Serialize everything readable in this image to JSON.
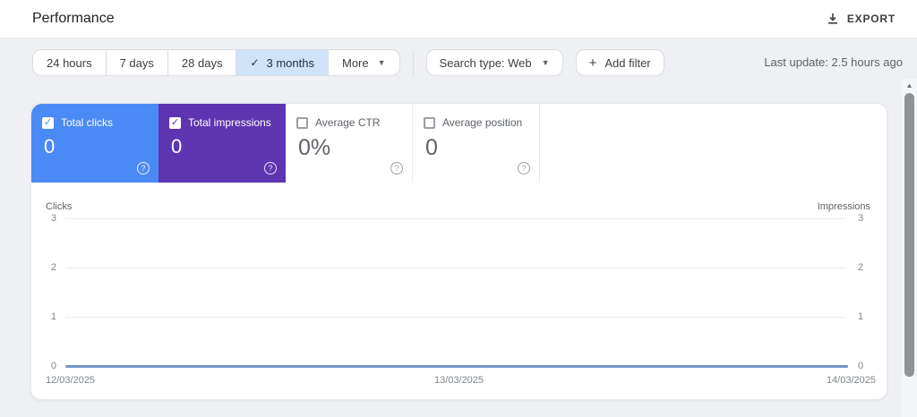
{
  "header": {
    "title": "Performance",
    "export_label": "EXPORT"
  },
  "filters": {
    "date_ranges": [
      {
        "label": "24 hours",
        "selected": false
      },
      {
        "label": "7 days",
        "selected": false
      },
      {
        "label": "28 days",
        "selected": false
      },
      {
        "label": "3 months",
        "selected": true
      }
    ],
    "more_label": "More",
    "search_type_label": "Search type: Web",
    "add_filter_label": "Add filter",
    "last_update": "Last update: 2.5 hours ago"
  },
  "metrics": {
    "cards": [
      {
        "label": "Total clicks",
        "value": "0",
        "checked": true,
        "color": "#4a8af4"
      },
      {
        "label": "Total impressions",
        "value": "0",
        "checked": true,
        "color": "#5e35b1"
      },
      {
        "label": "Average CTR",
        "value": "0%",
        "checked": false,
        "color": "#ffffff"
      },
      {
        "label": "Average position",
        "value": "0",
        "checked": false,
        "color": "#ffffff"
      }
    ]
  },
  "chart_data": {
    "type": "line",
    "title": "",
    "left_axis_label": "Clicks",
    "right_axis_label": "Impressions",
    "left_ticks": [
      "3",
      "2",
      "1",
      "0"
    ],
    "right_ticks": [
      "3",
      "2",
      "1",
      "0"
    ],
    "ylim_left": [
      0,
      3
    ],
    "ylim_right": [
      0,
      3
    ],
    "grid": true,
    "x": [
      "12/03/2025",
      "13/03/2025",
      "14/03/2025"
    ],
    "series": [
      {
        "name": "Total clicks",
        "values": [
          0,
          0,
          0
        ],
        "color": "#7295c5"
      },
      {
        "name": "Total impressions",
        "values": [
          0,
          0,
          0
        ],
        "color": "#7295c5"
      }
    ]
  },
  "icons": {
    "check": "✓",
    "caret": "▼",
    "plus": "+",
    "help": "?",
    "scroll_up": "▲"
  },
  "colors": {
    "selected_range_bg": "#cfe4f8",
    "clicks_accent": "#4a8af4",
    "impressions_accent": "#5e35b1"
  }
}
